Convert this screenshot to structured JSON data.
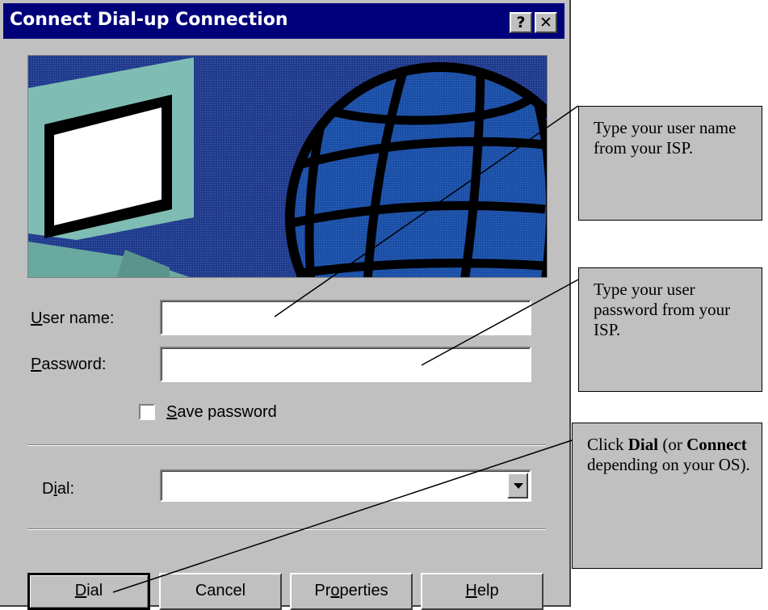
{
  "window": {
    "title": "Connect Dial-up Connection",
    "help_button": "?",
    "close_button": "✕"
  },
  "banner": {
    "icons": [
      "monitor-icon",
      "globe-icon"
    ]
  },
  "form": {
    "username": {
      "label_accel": "U",
      "label_rest": "ser name:",
      "value": ""
    },
    "password": {
      "label_accel": "P",
      "label_rest": "assword:",
      "value": ""
    },
    "save_password": {
      "label_accel": "S",
      "label_rest": "ave password",
      "checked": false
    },
    "dial": {
      "label_pre": "D",
      "label_accel": "i",
      "label_rest": "al:",
      "value": ""
    }
  },
  "buttons": {
    "dial": {
      "accel": "D",
      "rest": "ial"
    },
    "cancel": {
      "label": "Cancel"
    },
    "properties": {
      "pre": "Pr",
      "accel": "o",
      "rest": "perties"
    },
    "help": {
      "accel": "H",
      "rest": "elp"
    }
  },
  "callouts": {
    "username": "Type your user name from your ISP.",
    "password": "Type your user password from your ISP.",
    "dial": {
      "t1": "Click ",
      "b1": "Dial",
      "t2": " (or ",
      "b2": "Connect",
      "t3": " depending on your OS)."
    }
  },
  "colors": {
    "titlebar": "#00007b",
    "face": "#c0c0c0",
    "banner_bg": "#1f3c8a",
    "globe": "#1b4fa6",
    "monitor": "#7fbdb4"
  }
}
